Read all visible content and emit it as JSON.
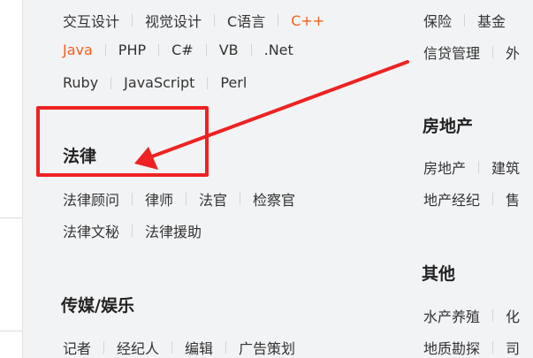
{
  "left_column": {
    "programming_rows": [
      [
        "交互设计",
        "视觉设计",
        "C语言",
        "C++"
      ],
      [
        "Java",
        "PHP",
        "C#",
        "VB",
        ".Net"
      ],
      [
        "Ruby",
        "JavaScript",
        "Perl"
      ]
    ],
    "hot_items": [
      "C++",
      "Java"
    ],
    "law": {
      "title": "法律",
      "rows": [
        [
          "法律顾问",
          "律师",
          "法官",
          "检察官"
        ],
        [
          "法律文秘",
          "法律援助"
        ]
      ]
    },
    "media": {
      "title": "传媒/娱乐",
      "rows": [
        [
          "记者",
          "经纪人",
          "编辑",
          "广告策划"
        ]
      ]
    }
  },
  "right_column": {
    "finance_rows": [
      [
        "保险",
        "基金"
      ],
      [
        "信贷管理",
        "外"
      ]
    ],
    "real_estate": {
      "title": "房地产",
      "rows": [
        [
          "房地产",
          "建筑"
        ],
        [
          "地产经纪",
          "售"
        ]
      ]
    },
    "other": {
      "title": "其他",
      "rows": [
        [
          "水产养殖",
          "化"
        ],
        [
          "地质勘探",
          "司"
        ]
      ]
    }
  },
  "annotation": {
    "color": "#ee2222"
  },
  "colors": {
    "hot": "#f2601d",
    "text": "#333333",
    "background": "#f2f3f5"
  }
}
